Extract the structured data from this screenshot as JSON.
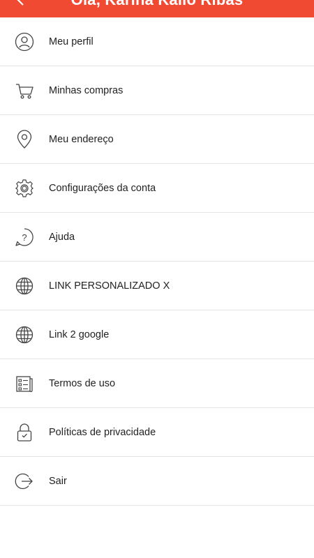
{
  "header": {
    "title": "Olá, Karina Kallo Ribas",
    "background_color": "#f04a32",
    "back_icon": "arrow-left-icon"
  },
  "menu": {
    "items": [
      {
        "label": "Meu perfil",
        "icon": "user-icon"
      },
      {
        "label": "Minhas compras",
        "icon": "cart-icon"
      },
      {
        "label": "Meu endereço",
        "icon": "location-pin-icon"
      },
      {
        "label": "Configurações da conta",
        "icon": "gear-icon"
      },
      {
        "label": "Ajuda",
        "icon": "help-bubble-icon"
      },
      {
        "label": "LINK PERSONALIZADO X",
        "icon": "globe-icon"
      },
      {
        "label": "Link 2 google",
        "icon": "globe-icon"
      },
      {
        "label": "Termos de uso",
        "icon": "document-checklist-icon"
      },
      {
        "label": "Políticas de privacidade",
        "icon": "lock-shield-icon"
      },
      {
        "label": "Sair",
        "icon": "logout-icon"
      }
    ]
  }
}
